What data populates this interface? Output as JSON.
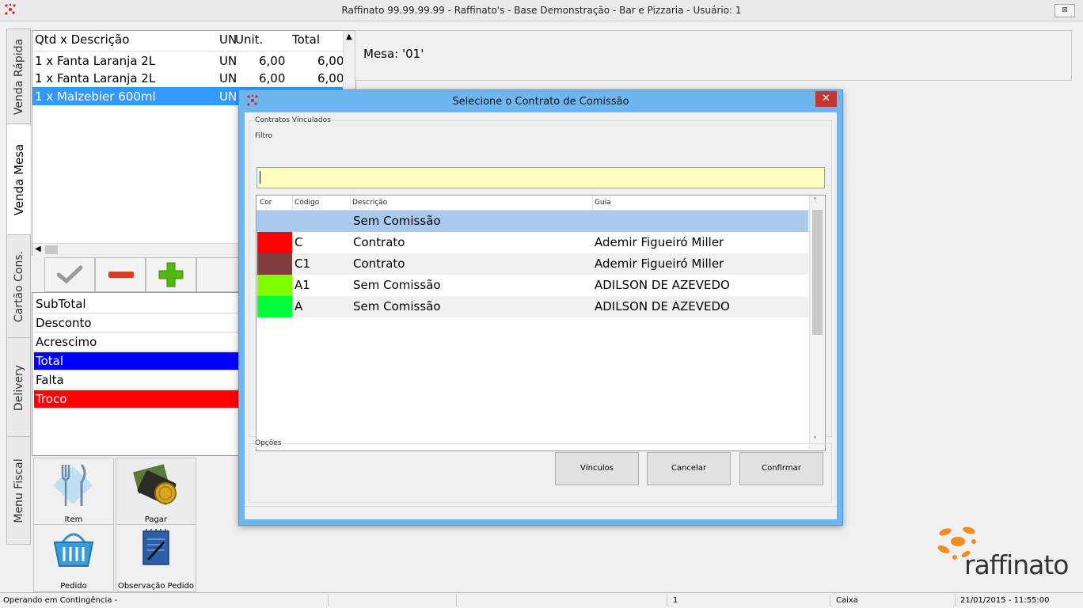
{
  "window": {
    "title": "Raffinato 99.99.99.99 - Raffinato's  - Base Demonstração - Bar e Pizzaria - Usuário: 1",
    "close_symbol": "⊠"
  },
  "side_tabs": [
    "Venda Rápida",
    "Venda Mesa",
    "Cartão Cons.",
    "Delivery",
    "Menu Fiscal"
  ],
  "order_grid": {
    "columns": [
      "Qtd x Descrição",
      "UN",
      "Unit.",
      "Total"
    ],
    "rows": [
      {
        "desc": "1 x Fanta Laranja 2L",
        "un": "UN",
        "unit": "6,00",
        "total": "6,00"
      },
      {
        "desc": "1 x Fanta Laranja 2L",
        "un": "UN",
        "unit": "6,00",
        "total": "6,00"
      },
      {
        "desc": "1 x Malzebier 600ml",
        "un": "UN",
        "unit": "",
        "total": ""
      }
    ]
  },
  "mesa_label": "Mesa: '01'",
  "totals": [
    {
      "label": "SubTotal",
      "bg": "#ffffff",
      "fg": "#000000"
    },
    {
      "label": "Desconto",
      "bg": "#ffffff",
      "fg": "#000000"
    },
    {
      "label": "Acrescimo",
      "bg": "#ffffff",
      "fg": "#000000"
    },
    {
      "label": "Total",
      "bg": "#0000ff",
      "fg": "#ffffff"
    },
    {
      "label": "Falta",
      "bg": "#ffffff",
      "fg": "#000000"
    },
    {
      "label": "Troco",
      "bg": "#ff0000",
      "fg": "#ffffff"
    }
  ],
  "tiles": {
    "item": "Item",
    "pagar": "Pagar",
    "pedido": "Pedido",
    "observacao": "Observação Pedido"
  },
  "brand": "raffinato",
  "status_bar": {
    "message": "Operando em Contingência -",
    "terminal": "1",
    "role": "Caixa",
    "datetime": "21/01/2015 - 11:55:00"
  },
  "dialog": {
    "title": "Selecione o Contrato de Comissão",
    "close_symbol": "✕",
    "group_label": "Contratos Vínculados",
    "filter_label": "Filtro",
    "filter_value": "",
    "columns": [
      "Cor",
      "Código",
      "Descrição",
      "Guia"
    ],
    "rows": [
      {
        "color": "#a9c9ed",
        "code": "",
        "desc": "Sem Comissão",
        "guide": "",
        "selected": true
      },
      {
        "color": "#ff0000",
        "code": "C",
        "desc": "Contrato",
        "guide": "Ademir Figueiró Miller",
        "selected": false
      },
      {
        "color": "#7f3f3f",
        "code": "C1",
        "desc": "Contrato",
        "guide": "Ademir Figueiró Miller",
        "selected": false
      },
      {
        "color": "#80ff00",
        "code": "A1",
        "desc": "Sem Comissão",
        "guide": "ADILSON DE AZEVEDO",
        "selected": false
      },
      {
        "color": "#00ff3a",
        "code": "A",
        "desc": "Sem Comissão",
        "guide": "ADILSON DE AZEVEDO",
        "selected": false
      }
    ],
    "options_label": "Opções",
    "buttons": {
      "vinculos": "Vínculos",
      "cancelar": "Cancelar",
      "confirmar": "Confirmar"
    }
  }
}
